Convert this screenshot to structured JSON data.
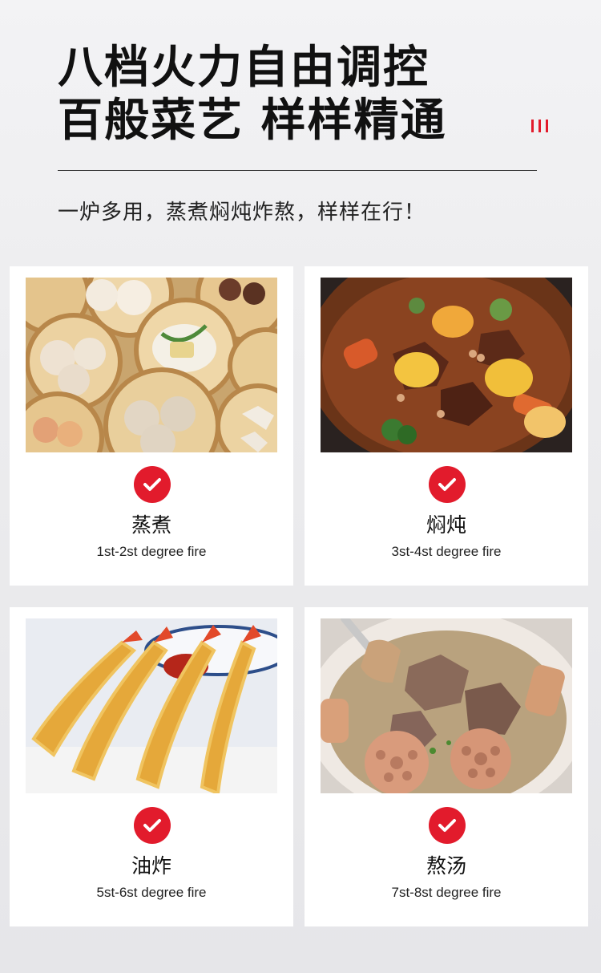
{
  "header": {
    "title_line1": "八档火力自由调控",
    "title_line2": "百般菜艺 样样精通",
    "subtitle": "一炉多用，蒸煮焖炖炸熬，样样在行！",
    "accent_color": "#e21b2c"
  },
  "cards": [
    {
      "title": "蒸煮",
      "subtitle": "1st-2st degree fire",
      "photo": "steamed-dumplings-photo"
    },
    {
      "title": "焖炖",
      "subtitle": "3st-4st degree fire",
      "photo": "braised-beef-stew-photo"
    },
    {
      "title": "油炸",
      "subtitle": "5st-6st degree fire",
      "photo": "fried-shrimp-tempura-photo"
    },
    {
      "title": "熬汤",
      "subtitle": "7st-8st degree fire",
      "photo": "pork-rib-lotus-soup-photo"
    }
  ]
}
